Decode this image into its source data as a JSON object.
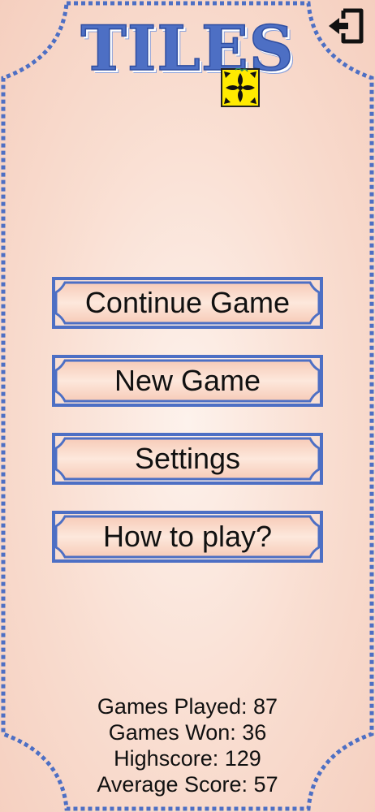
{
  "app": {
    "title": "TILES"
  },
  "colors": {
    "background": "#f9ddd0",
    "accent": "#4d6fc4",
    "tile_yellow": "#ffea00",
    "text": "#111111"
  },
  "icons": {
    "exit": "exit-door-icon",
    "logo": "tile-flower-icon"
  },
  "menu": {
    "continue_label": "Continue Game",
    "new_label": "New Game",
    "settings_label": "Settings",
    "howto_label": "How to play?"
  },
  "stats": {
    "played_label": "Games Played:",
    "played_value": "87",
    "won_label": "Games Won:",
    "won_value": "36",
    "highscore_label": "Highscore:",
    "highscore_value": "129",
    "average_label": "Average Score:",
    "average_value": "57"
  }
}
